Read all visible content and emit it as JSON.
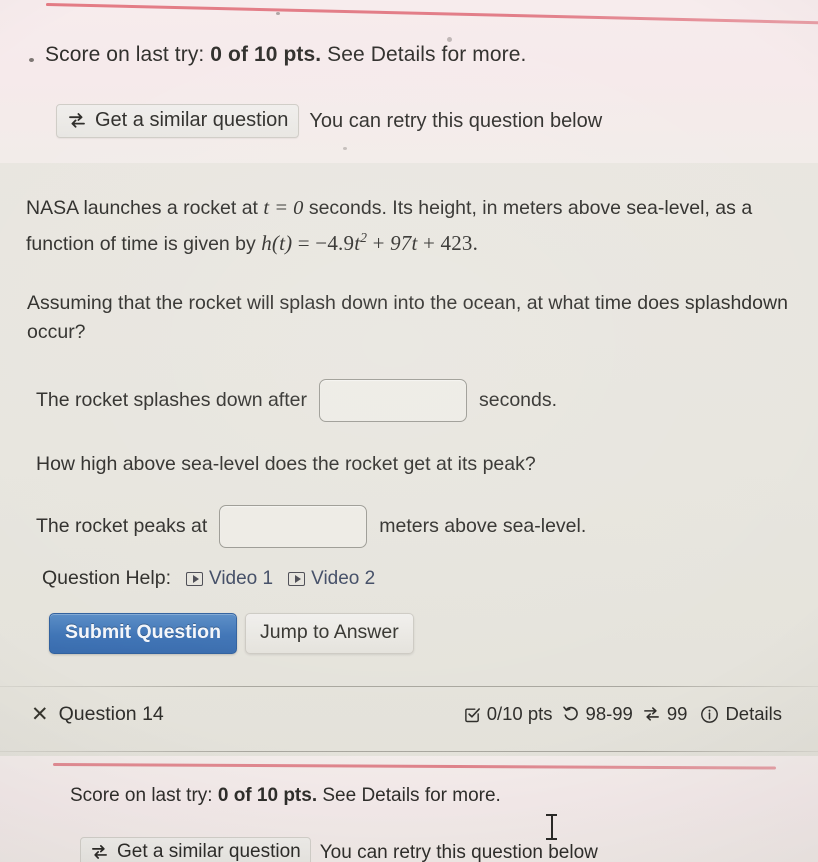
{
  "top_alert": {
    "score_prefix": "Score on last try: ",
    "score_value": "0 of 10 pts.",
    "score_suffix": " See Details for more.",
    "similar_button_label": "Get a similar question",
    "similar_button_icon": "swap-arrows-icon",
    "retry_note": "You can retry this question below",
    "rule_color": "#e2727c",
    "background": "#f6eaeb"
  },
  "question": {
    "paragraph_1_before_math": "NASA launches a rocket at ",
    "paragraph_1_math_t": "t = 0",
    "paragraph_1_after_math": " seconds. Its height, in meters above sea-level, as a function of time is given by ",
    "equation": "h(t) = −4.9t² + 97t + 423.",
    "equation_parts": {
      "lhs": "h(t)",
      "equals": "=",
      "term_quadratic_coefficient": "−4.9",
      "term_quadratic_variable": "t",
      "term_quadratic_exponent": "2",
      "plus_1": "+",
      "term_linear": "97t",
      "plus_2": "+",
      "constant": "423",
      "period": "."
    },
    "paragraph_2": "Assuming that the rocket will splash down into the ocean, at what time does splashdown occur?",
    "answer_1_prefix": "The rocket splashes down after",
    "answer_1_value": "",
    "answer_1_placeholder": "",
    "answer_1_suffix": "seconds.",
    "paragraph_3": "How high above sea-level does the rocket get at its peak?",
    "answer_2_prefix": "The rocket peaks at",
    "answer_2_value": "",
    "answer_2_placeholder": "",
    "answer_2_suffix": "meters above sea-level."
  },
  "help": {
    "label": "Question Help:",
    "links": [
      {
        "label": "Video 1",
        "icon": "video-play-icon"
      },
      {
        "label": "Video 2",
        "icon": "video-play-icon"
      }
    ]
  },
  "actions": {
    "submit_label": "Submit Question",
    "submit_color": "#3f74b6",
    "jump_label": "Jump to Answer"
  },
  "status_bar": {
    "mark_icon": "x-mark-icon",
    "question_label": "Question 14",
    "points_icon": "checkbox-check-icon",
    "points_label": "0/10 pts",
    "attempts_icon": "rotate-ccw-icon",
    "attempts_label": "98-99",
    "versions_icon": "swap-arrows-icon",
    "versions_label": "99",
    "details_icon": "info-circle-icon",
    "details_label": "Details"
  },
  "bottom_alert": {
    "score_prefix": "Score on last try: ",
    "score_value": "0 of 10 pts.",
    "score_suffix": " See Details for more.",
    "similar_button_label": "Get a similar question",
    "similar_button_icon": "swap-arrows-icon",
    "retry_note": "You can retry this question below",
    "rule_color": "#dd7b84"
  }
}
